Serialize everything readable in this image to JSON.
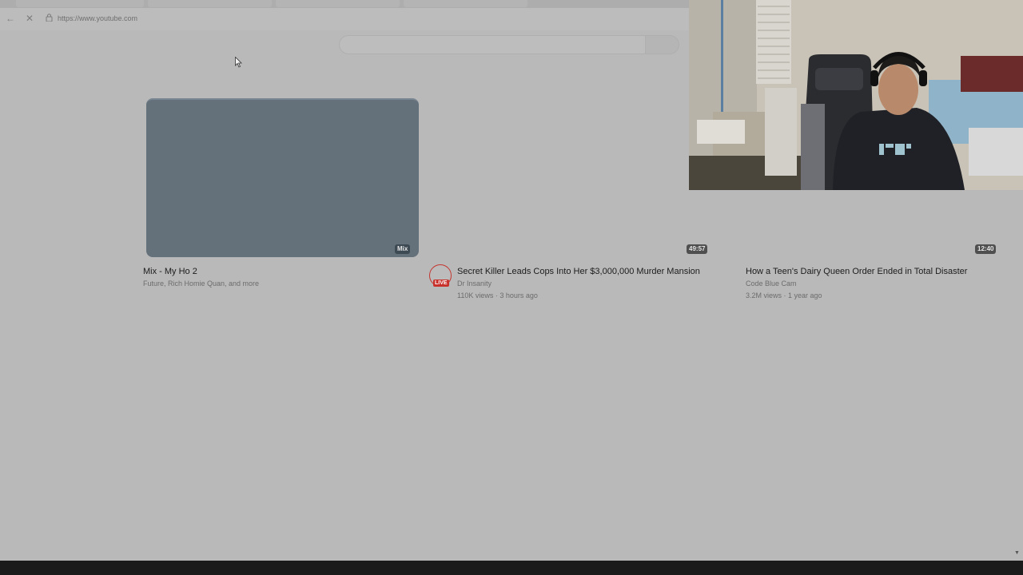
{
  "browser": {
    "url": "https://www.youtube.com",
    "back_icon": "back-arrow-icon",
    "stop_icon": "close-icon",
    "lock_icon": "lock-icon"
  },
  "videos": [
    {
      "title": "Mix - My Ho 2",
      "channel": "Future, Rich Homie Quan, and more",
      "stats": "",
      "badge": "Mix"
    },
    {
      "title": "Secret Killer Leads Cops Into Her $3,000,000 Murder Mansion",
      "channel": "Dr Insanity",
      "stats": "110K views · 3 hours ago",
      "badge": "49:57",
      "avatar_label": "LIVE"
    },
    {
      "title": "How a Teen's Dairy Queen Order Ended in Total Disaster",
      "channel": "Code Blue Cam",
      "stats": "3.2M views · 1 year ago",
      "badge": "12:40"
    }
  ],
  "colors": {
    "overlay": "#b9b9b9",
    "thumbnail": "#64717b",
    "live_red": "#c8302b"
  }
}
